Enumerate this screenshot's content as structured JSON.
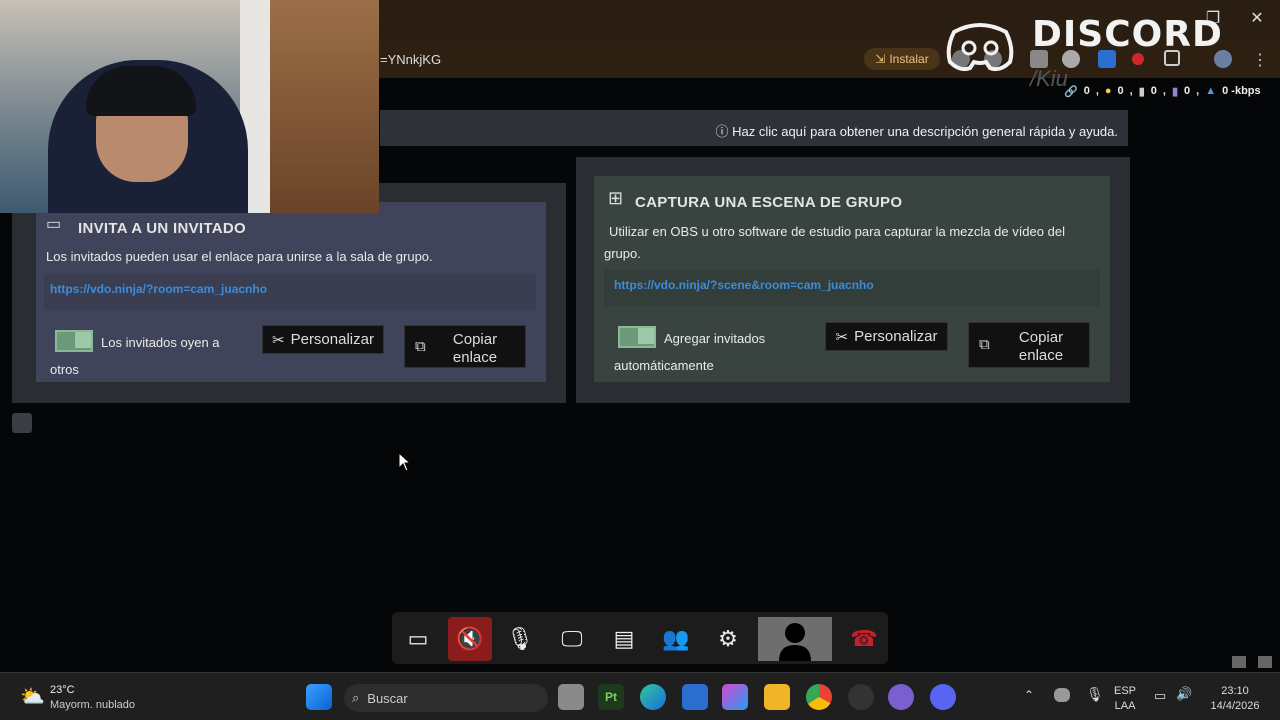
{
  "browser": {
    "url_fragment": "=YNnkjKG",
    "install_label": "Instalar",
    "window_controls": [
      "minimize-icon",
      "restore-icon",
      "close-icon"
    ]
  },
  "discord_overlay": {
    "wordmark": "DISCORD",
    "sub": "/Kiu"
  },
  "stats": {
    "items": [
      "0",
      "0",
      "0",
      "0",
      "0",
      "0 -kbps"
    ]
  },
  "help": {
    "text": "Haz clic aquí para obtener una descripción general rápida y ayuda."
  },
  "guest_card": {
    "title": "INVITA A UN INVITADO",
    "desc": "Los invitados pueden usar el enlace para unirse a la sala de grupo.",
    "link": "https://vdo.ninja/?room=cam_juacnho",
    "toggle_label_1": "Los invitados oyen a",
    "toggle_label_2": "otros",
    "customize": "Personalizar",
    "copy_1": "Copiar",
    "copy_2": "enlace"
  },
  "scene_card": {
    "title": "CAPTURA UNA ESCENA DE GRUPO",
    "desc_1": "Utilizar en OBS u otro software de estudio para capturar la mezcla de vídeo del",
    "desc_2": "grupo.",
    "link": "https://vdo.ninja/?scene&room=cam_juacnho",
    "toggle_label_1": "Agregar invitados",
    "toggle_label_2": "automáticamente",
    "customize": "Personalizar",
    "copy_1": "Copiar",
    "copy_2": "enlace"
  },
  "toolbar": {
    "buttons": [
      "chat-icon",
      "speaker-muted-icon",
      "microphone-icon",
      "screen-share-icon",
      "list-icon",
      "guests-settings-icon",
      "gear-icon",
      "user-video-icon",
      "hangup-icon"
    ]
  },
  "taskbar": {
    "weather_temp": "23°C",
    "weather_desc": "Mayorm. nublado",
    "search_placeholder": "Buscar",
    "lang_1": "ESP",
    "lang_2": "LAA",
    "time": "23:10",
    "date": "14/4/2026"
  },
  "colors": {
    "accent_link": "#3d8cd8",
    "hangup": "#c8202a",
    "muted_bg": "#8b1c1c"
  }
}
